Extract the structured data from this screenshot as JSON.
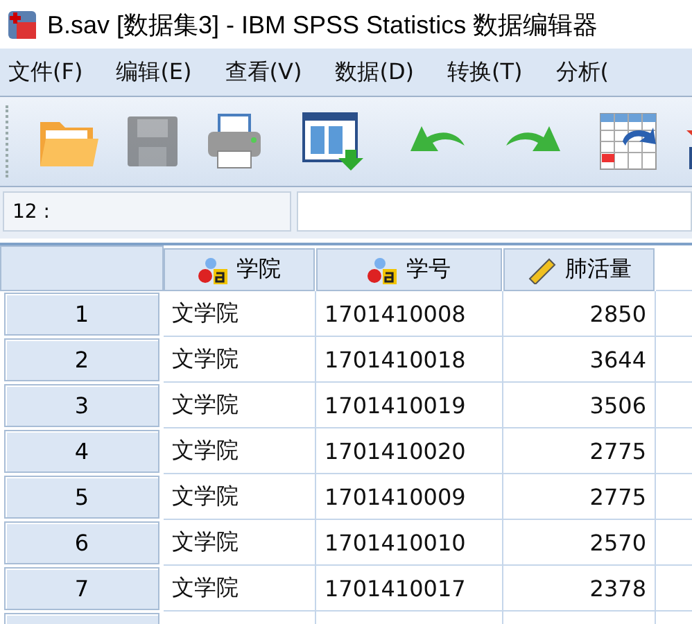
{
  "window": {
    "title": "B.sav [数据集3] - IBM SPSS Statistics 数据编辑器"
  },
  "menu": [
    "文件(F)",
    "编辑(E)",
    "查看(V)",
    "数据(D)",
    "转换(T)",
    "分析("
  ],
  "toolbar": [
    {
      "kind": "open",
      "disabled": false
    },
    {
      "kind": "save",
      "disabled": true
    },
    {
      "kind": "print",
      "disabled": false
    },
    {
      "kind": "recall",
      "disabled": false
    },
    {
      "kind": "undo",
      "disabled": false
    },
    {
      "kind": "redo",
      "disabled": false
    },
    {
      "kind": "goto",
      "disabled": false
    },
    {
      "kind": "insert",
      "disabled": false
    }
  ],
  "cell_editor": {
    "cell_ref": "12 :"
  },
  "table": {
    "columns": [
      {
        "label": "学院",
        "kind": "nominal"
      },
      {
        "label": "学号",
        "kind": "nominal"
      },
      {
        "label": "肺活量",
        "kind": "scale"
      }
    ],
    "rows": [
      {
        "number": "1",
        "cells": [
          "文学院",
          "1701410008",
          "2850"
        ]
      },
      {
        "number": "2",
        "cells": [
          "文学院",
          "1701410018",
          "3644"
        ]
      },
      {
        "number": "3",
        "cells": [
          "文学院",
          "1701410019",
          "3506"
        ]
      },
      {
        "number": "4",
        "cells": [
          "文学院",
          "1701410020",
          "2775"
        ]
      },
      {
        "number": "5",
        "cells": [
          "文学院",
          "1701410009",
          "2775"
        ]
      },
      {
        "number": "6",
        "cells": [
          "文学院",
          "1701410010",
          "2570"
        ]
      },
      {
        "number": "7",
        "cells": [
          "文学院",
          "1701410017",
          "2378"
        ]
      }
    ]
  }
}
